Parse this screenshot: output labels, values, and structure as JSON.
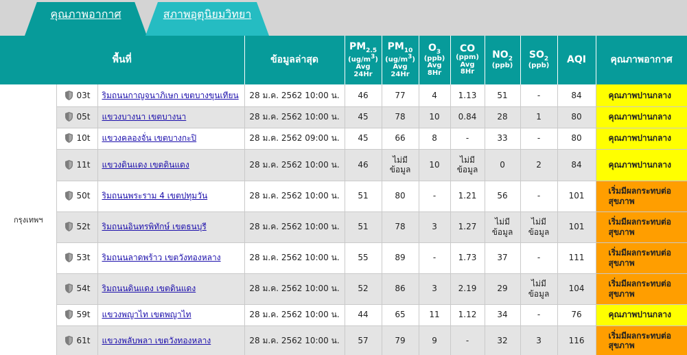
{
  "tabs": [
    {
      "label": "คุณภาพอากาศ",
      "active": true
    },
    {
      "label": "สภาพอุตุนิยมวิทยา",
      "active": false
    }
  ],
  "headers": {
    "area": "พื้นที่",
    "latest": "ข้อมูลล่าสุด",
    "pm25": {
      "name": "PM",
      "subscript": "2.5",
      "unit": "(ug/m",
      "unit_sup": "3",
      "unit_end": ")",
      "avg": "Avg",
      "period": "24Hr"
    },
    "pm10": {
      "name": "PM",
      "subscript": "10",
      "unit": "(ug/m",
      "unit_sup": "3",
      "unit_end": ")",
      "avg": "Avg",
      "period": "24Hr"
    },
    "o3": {
      "name": "O",
      "subscript": "3",
      "unit": "(ppb)",
      "avg": "Avg",
      "period": "8Hr"
    },
    "co": {
      "name": "CO",
      "unit": "(ppm)",
      "avg": "Avg",
      "period": "8Hr"
    },
    "no2": {
      "name": "NO",
      "subscript": "2",
      "unit": "(ppb)"
    },
    "so2": {
      "name": "SO",
      "subscript": "2",
      "unit": "(ppb)"
    },
    "aqi": "AQI",
    "quality": "คุณภาพอากาศ"
  },
  "province": "กรุงเทพฯ",
  "colors": {
    "tab_active": "#079b9a",
    "tab_inactive": "#25bcc2",
    "header_bg": "#079b9a",
    "moderate": "#ffff00",
    "unhealthy_sensitive": "#ff9e00"
  },
  "rows": [
    {
      "code": "03t",
      "area": "ริมถนนกาญจนาภิเษก เขตบางขุนเทียน",
      "time": "28 ม.ค. 2562 10:00 น.",
      "pm25": "46",
      "pm10": "77",
      "o3": "4",
      "co": "1.13",
      "no2": "51",
      "so2": "-",
      "aqi": "84",
      "quality": "คุณภาพปานกลาง",
      "level": "mod"
    },
    {
      "code": "05t",
      "area": "แขวงบางนา เขตบางนา",
      "time": "28 ม.ค. 2562 10:00 น.",
      "pm25": "45",
      "pm10": "78",
      "o3": "10",
      "co": "0.84",
      "no2": "28",
      "so2": "1",
      "aqi": "80",
      "quality": "คุณภาพปานกลาง",
      "level": "mod"
    },
    {
      "code": "10t",
      "area": "แขวงคลองจั่น เขตบางกะปิ",
      "time": "28 ม.ค. 2562 09:00 น.",
      "pm25": "45",
      "pm10": "66",
      "o3": "8",
      "co": "-",
      "no2": "33",
      "so2": "-",
      "aqi": "80",
      "quality": "คุณภาพปานกลาง",
      "level": "mod"
    },
    {
      "code": "11t",
      "area": "แขวงดินแดง เขตดินแดง",
      "time": "28 ม.ค. 2562 10:00 น.",
      "pm25": "46",
      "pm10": "ไม่มี ข้อมูล",
      "o3": "10",
      "co": "ไม่มี ข้อมูล",
      "no2": "0",
      "so2": "2",
      "aqi": "84",
      "quality": "คุณภาพปานกลาง",
      "level": "mod"
    },
    {
      "code": "50t",
      "area": "ริมถนนพระราม 4 เขตปทุมวัน",
      "time": "28 ม.ค. 2562 10:00 น.",
      "pm25": "51",
      "pm10": "80",
      "o3": "-",
      "co": "1.21",
      "no2": "56",
      "so2": "-",
      "aqi": "101",
      "quality": "เริ่มมีผลกระทบต่อ สุขภาพ",
      "level": "usg"
    },
    {
      "code": "52t",
      "area": "ริมถนนอินทรพิทักษ์ เขตธนบุรี",
      "time": "28 ม.ค. 2562 10:00 น.",
      "pm25": "51",
      "pm10": "78",
      "o3": "3",
      "co": "1.27",
      "no2": "ไม่มี ข้อมูล",
      "so2": "ไม่มี ข้อมูล",
      "aqi": "101",
      "quality": "เริ่มมีผลกระทบต่อ สุขภาพ",
      "level": "usg"
    },
    {
      "code": "53t",
      "area": "ริมถนนลาดพร้าว เขตวังทองหลาง",
      "time": "28 ม.ค. 2562 10:00 น.",
      "pm25": "55",
      "pm10": "89",
      "o3": "-",
      "co": "1.73",
      "no2": "37",
      "so2": "-",
      "aqi": "111",
      "quality": "เริ่มมีผลกระทบต่อ สุขภาพ",
      "level": "usg"
    },
    {
      "code": "54t",
      "area": "ริมถนนดินแดง เขตดินแดง",
      "time": "28 ม.ค. 2562 10:00 น.",
      "pm25": "52",
      "pm10": "86",
      "o3": "3",
      "co": "2.19",
      "no2": "29",
      "so2": "ไม่มี ข้อมูล",
      "aqi": "104",
      "quality": "เริ่มมีผลกระทบต่อ สุขภาพ",
      "level": "usg"
    },
    {
      "code": "59t",
      "area": "แขวงพญาไท เขตพญาไท",
      "time": "28 ม.ค. 2562 10:00 น.",
      "pm25": "44",
      "pm10": "65",
      "o3": "11",
      "co": "1.12",
      "no2": "34",
      "so2": "-",
      "aqi": "76",
      "quality": "คุณภาพปานกลาง",
      "level": "mod"
    },
    {
      "code": "61t",
      "area": "แขวงพลับพลา เขตวังทองหลาง",
      "time": "28 ม.ค. 2562 10:00 น.",
      "pm25": "57",
      "pm10": "79",
      "o3": "9",
      "co": "-",
      "no2": "32",
      "so2": "3",
      "aqi": "116",
      "quality": "เริ่มมีผลกระทบต่อ สุขภาพ",
      "level": "usg"
    }
  ]
}
